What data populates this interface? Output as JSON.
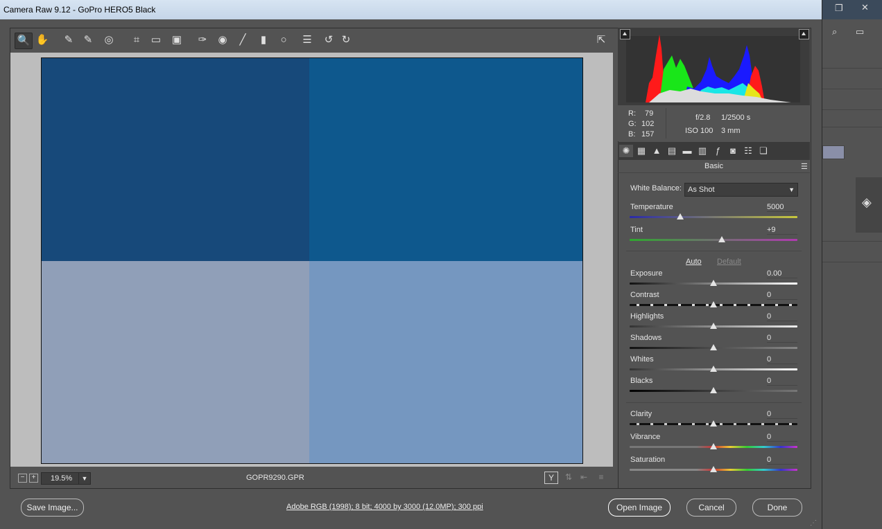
{
  "window": {
    "title": "Camera Raw 9.12  -  GoPro HERO5 Black"
  },
  "toolbar": {
    "tools": [
      {
        "name": "zoom-tool-icon",
        "glyph": "🔍"
      },
      {
        "name": "hand-tool-icon",
        "glyph": "✋"
      },
      {
        "name": "white-balance-tool-icon",
        "glyph": "✎"
      },
      {
        "name": "color-sampler-tool-icon",
        "glyph": "✎"
      },
      {
        "name": "targeted-adjustment-tool-icon",
        "glyph": "◎"
      },
      {
        "name": "crop-tool-icon",
        "glyph": "⌗"
      },
      {
        "name": "straighten-tool-icon",
        "glyph": "▭"
      },
      {
        "name": "transform-tool-icon",
        "glyph": "▣"
      },
      {
        "name": "spot-removal-tool-icon",
        "glyph": "✑"
      },
      {
        "name": "red-eye-tool-icon",
        "glyph": "◉"
      },
      {
        "name": "adjustment-brush-icon",
        "glyph": "╱"
      },
      {
        "name": "graduated-filter-icon",
        "glyph": "▮"
      },
      {
        "name": "radial-filter-icon",
        "glyph": "○"
      },
      {
        "name": "preferences-icon",
        "glyph": "☰"
      },
      {
        "name": "rotate-left-icon",
        "glyph": "↺"
      },
      {
        "name": "rotate-right-icon",
        "glyph": "↻"
      }
    ],
    "fullscreen_icon": "⇱"
  },
  "statusbar": {
    "zoom_out": "−",
    "zoom_in": "+",
    "zoom": "19.5%",
    "filename": "GOPR9290.GPR"
  },
  "readout": {
    "r_label": "R:",
    "r": "79",
    "g_label": "G:",
    "g": "102",
    "b_label": "B:",
    "b": "157",
    "aperture": "f/2.8",
    "shutter": "1/2500 s",
    "iso": "ISO 100",
    "focal": "3 mm"
  },
  "panel": {
    "title": "Basic",
    "white_balance_label": "White Balance:",
    "white_balance_value": "As Shot",
    "auto": "Auto",
    "default": "Default",
    "sliders": [
      {
        "label": "Temperature",
        "value": "5000",
        "level": 0.3
      },
      {
        "label": "Tint",
        "value": "+9",
        "level": 0.55
      },
      {
        "label": "Exposure",
        "value": "0.00",
        "level": 0.5
      },
      {
        "label": "Contrast",
        "value": "0",
        "level": 0.5
      },
      {
        "label": "Highlights",
        "value": "0",
        "level": 0.5
      },
      {
        "label": "Shadows",
        "value": "0",
        "level": 0.5
      },
      {
        "label": "Whites",
        "value": "0",
        "level": 0.5
      },
      {
        "label": "Blacks",
        "value": "0",
        "level": 0.5
      },
      {
        "label": "Clarity",
        "value": "0",
        "level": 0.5
      },
      {
        "label": "Vibrance",
        "value": "0",
        "level": 0.5
      },
      {
        "label": "Saturation",
        "value": "0",
        "level": 0.5
      }
    ]
  },
  "footer": {
    "save": "Save Image...",
    "info": "Adobe RGB (1998); 8 bit; 4000 by 3000 (12.0MP); 300 ppi",
    "open": "Open Image",
    "cancel": "Cancel",
    "done": "Done"
  },
  "colors": {
    "quad_top_left": "#17497a",
    "quad_top_right": "#0e588d",
    "quad_bottom_left": "#909fb8",
    "quad_bottom_right": "#7597c0"
  }
}
